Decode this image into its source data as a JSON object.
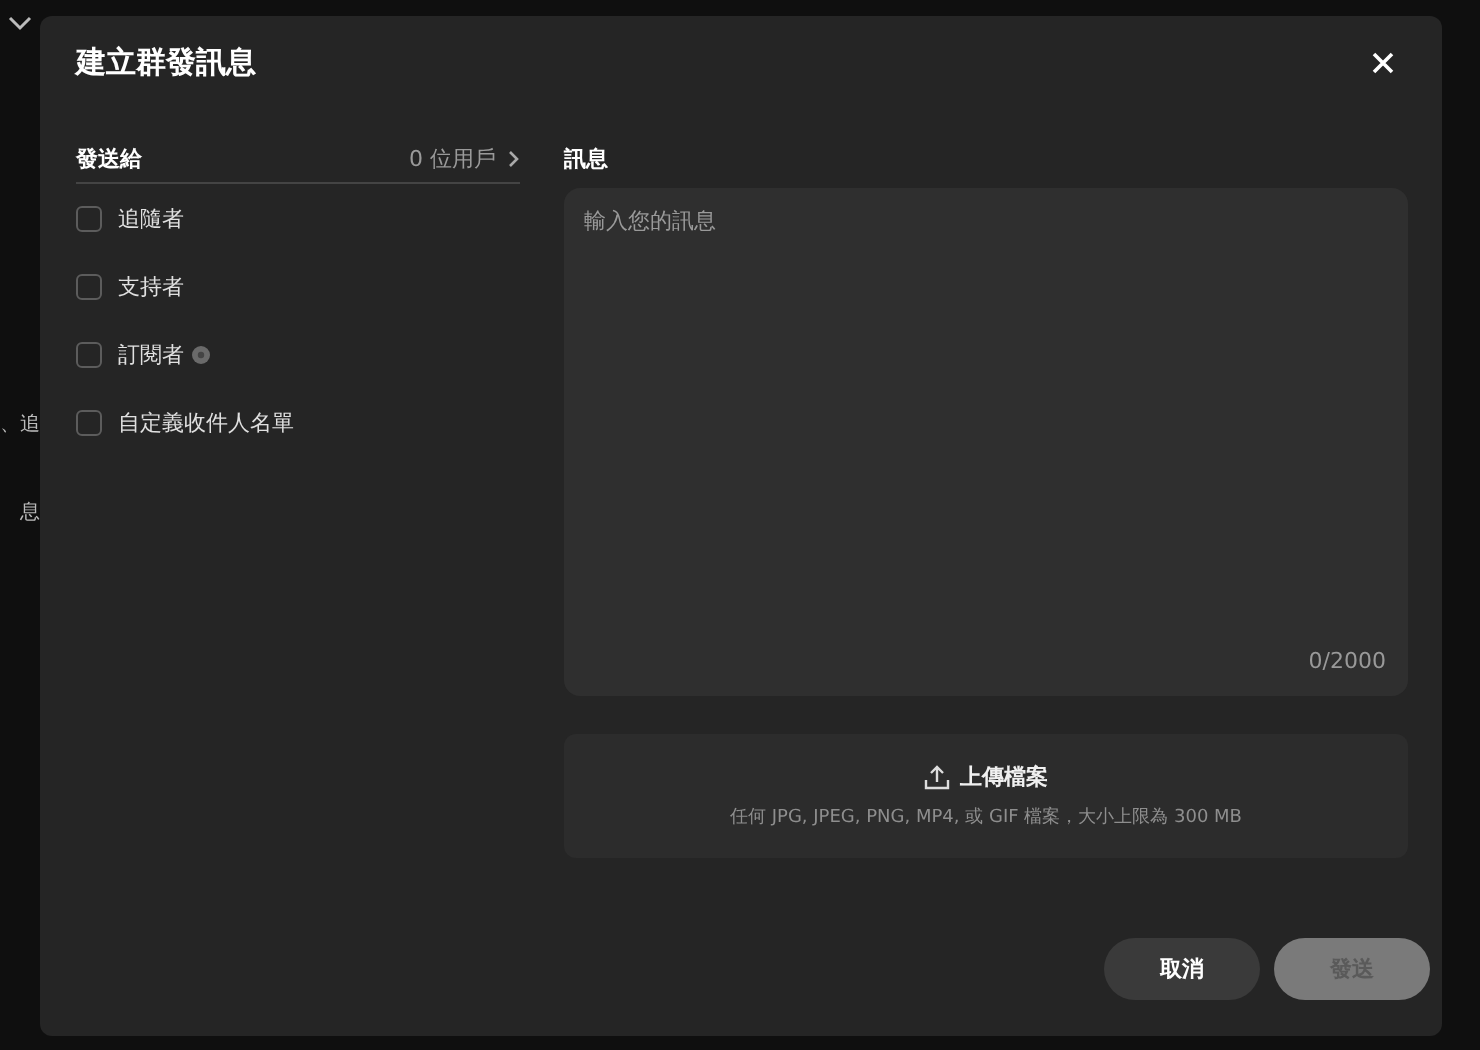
{
  "background": {
    "texts": [
      "、追",
      "息"
    ]
  },
  "dialog": {
    "title": "建立群發訊息",
    "recipients": {
      "label": "發送給",
      "count": "0 位用戶",
      "options": [
        {
          "label": "追隨者",
          "checked": false,
          "info": false
        },
        {
          "label": "支持者",
          "checked": false,
          "info": false
        },
        {
          "label": "訂閱者",
          "checked": false,
          "info": true
        },
        {
          "label": "自定義收件人名單",
          "checked": false,
          "info": false
        }
      ]
    },
    "message": {
      "label": "訊息",
      "placeholder": "輸入您的訊息",
      "counter": "0/2000"
    },
    "upload": {
      "label": "上傳檔案",
      "hint": "任何 JPG, JPEG, PNG, MP4, 或 GIF 檔案，大小上限為 300 MB"
    },
    "buttons": [
      {
        "label": "取消",
        "kind": "secondary",
        "disabled": false
      },
      {
        "label": "發送",
        "kind": "primary",
        "disabled": true
      }
    ]
  }
}
